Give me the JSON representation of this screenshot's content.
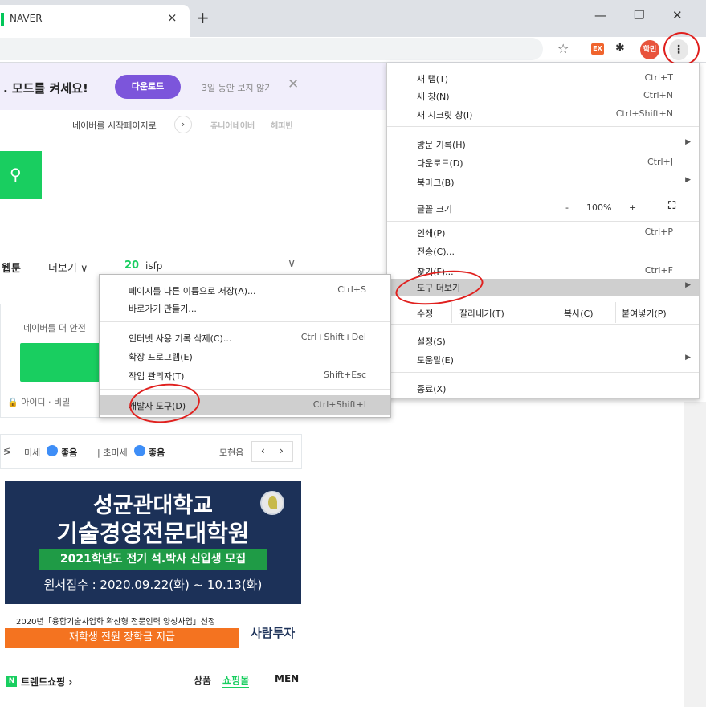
{
  "tab": {
    "title": "NAVER",
    "close": "×",
    "new_tab": "+"
  },
  "window": {
    "minimize": "—",
    "maximize": "❐",
    "close": "✕"
  },
  "toolbar": {
    "ext_label": "EX",
    "avatar_label": "학민",
    "menu_glyph": "⋮"
  },
  "banner": {
    "title": ". 모드를 켜세요!",
    "download": "다운로드",
    "hide": "3일 동안 보지 않기",
    "close": "✕"
  },
  "links": {
    "startpage": "네이버를 시작페이지로",
    "startpage_arrow": "›",
    "junior": "쥬니어네이버",
    "happybean": "해피빈"
  },
  "nav": {
    "webtoon": "웹툰",
    "more": "더보기 ∨",
    "rank": "20",
    "keyword": "isfp",
    "expand": "∨"
  },
  "login": {
    "message": "네이버를 더 안전",
    "id_link": "🔒 아이디 · 비밀"
  },
  "weather": {
    "edge": "≶",
    "fine_dust": "미세",
    "good1": "좋음",
    "ultrafine": "| 초미세",
    "good2": "좋음",
    "location": "모현읍",
    "prev": "‹",
    "next": "›"
  },
  "ad": {
    "line1": "성균관대학교",
    "line2": "기술경영전문대학원",
    "strip": "2021학년도 전기 석.박사 신입생 모집",
    "line3": "원서접수 : 2020.09.22(화) ~ 10.13(화)",
    "note": "2020년「융합기술사업화 확산형 전문인력 양성사업」선정",
    "scholarship": "재학생 전원 장학금 지급",
    "brand": "사람투자"
  },
  "trend": {
    "n": "N",
    "label": "트렌드쇼핑 ›",
    "tab_products": "상품",
    "tab_mall": "쇼핑몰",
    "tab_men": "MEN"
  },
  "main_menu": {
    "new_tab": {
      "label": "새 탭(T)",
      "shortcut": "Ctrl+T"
    },
    "new_window": {
      "label": "새 창(N)",
      "shortcut": "Ctrl+N"
    },
    "incognito": {
      "label": "새 시크릿 창(I)",
      "shortcut": "Ctrl+Shift+N"
    },
    "history": {
      "label": "방문 기록(H)",
      "arrow": "▶"
    },
    "downloads": {
      "label": "다운로드(D)",
      "shortcut": "Ctrl+J"
    },
    "bookmarks": {
      "label": "북마크(B)",
      "arrow": "▶"
    },
    "zoom": {
      "label": "글꼴 크기",
      "minus": "-",
      "value": "100%",
      "plus": "+",
      "fullscreen": "⛶"
    },
    "print": {
      "label": "인쇄(P)",
      "shortcut": "Ctrl+P"
    },
    "cast": {
      "label": "전송(C)..."
    },
    "find": {
      "label": "찾기(F)...",
      "shortcut": "Ctrl+F"
    },
    "more_tools": {
      "label": "도구 더보기",
      "arrow": "▶"
    },
    "edit": {
      "label": "수정",
      "cut": "잘라내기(T)",
      "copy": "복사(C)",
      "paste": "붙여넣기(P)"
    },
    "settings": {
      "label": "설정(S)"
    },
    "help": {
      "label": "도움말(E)",
      "arrow": "▶"
    },
    "exit": {
      "label": "종료(X)"
    }
  },
  "sub_menu": {
    "save_page": {
      "label": "페이지를 다른 이름으로 저장(A)...",
      "shortcut": "Ctrl+S"
    },
    "create_shortcut": {
      "label": "바로가기 만들기..."
    },
    "clear_data": {
      "label": "인터넷 사용 기록 삭제(C)...",
      "shortcut": "Ctrl+Shift+Del"
    },
    "extensions": {
      "label": "확장 프로그램(E)"
    },
    "task_manager": {
      "label": "작업 관리자(T)",
      "shortcut": "Shift+Esc"
    },
    "devtools": {
      "label": "개발자 도구(D)",
      "shortcut": "Ctrl+Shift+I"
    }
  },
  "colors": {
    "naver_green": "#19ce60",
    "annotation_red": "#e0201e",
    "banner_purple": "#7c55db"
  }
}
